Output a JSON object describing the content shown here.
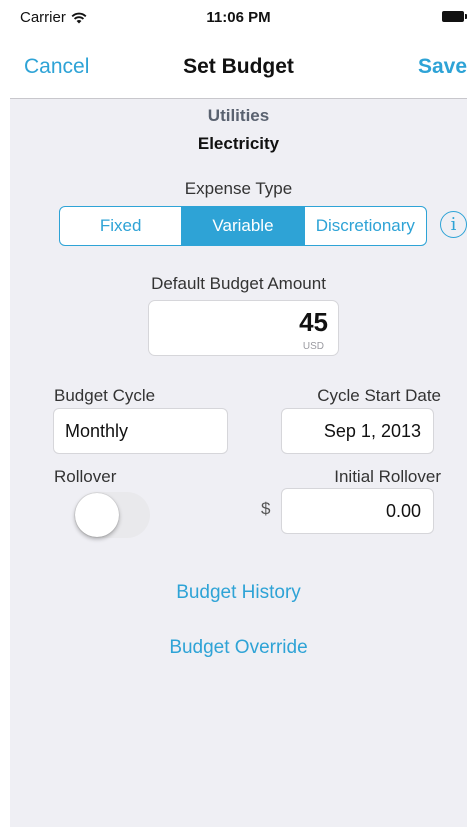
{
  "status_bar": {
    "carrier": "Carrier",
    "time": "11:06 PM",
    "icons": [
      "wifi-icon",
      "battery-icon"
    ]
  },
  "nav": {
    "cancel_label": "Cancel",
    "title": "Set Budget",
    "save_label": "Save"
  },
  "header": {
    "category": "Utilities",
    "subcategory": "Electricity"
  },
  "expense_type": {
    "label": "Expense Type",
    "options": [
      "Fixed",
      "Variable",
      "Discretionary"
    ],
    "selected": "Variable",
    "info_icon_glyph": "i"
  },
  "default_budget": {
    "label": "Default Budget Amount",
    "value": "45",
    "currency": "USD"
  },
  "budget_cycle": {
    "label": "Budget Cycle",
    "value": "Monthly"
  },
  "cycle_start": {
    "label": "Cycle Start Date",
    "value": "Sep 1, 2013"
  },
  "rollover": {
    "label": "Rollover",
    "enabled": false
  },
  "initial_rollover": {
    "label": "Initial Rollover",
    "currency_symbol": "$",
    "value": "0.00"
  },
  "links": {
    "budget_history": "Budget History",
    "budget_override": "Budget Override"
  },
  "colors": {
    "accent": "#2ea3d6",
    "background": "#efeff4"
  }
}
